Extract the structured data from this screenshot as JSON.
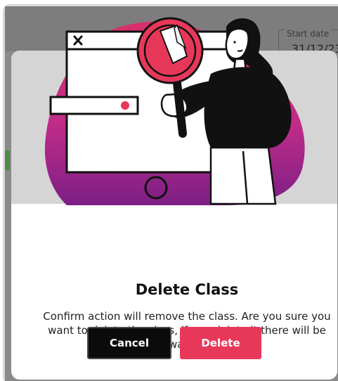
{
  "background": {
    "start_date_label": "Start date",
    "start_date_value": "31/12/23"
  },
  "dialog": {
    "title": "Delete Class",
    "message": "Confirm action will remove the class. Are you sure you want to delete the class, if you delete it there will be no way back.",
    "cancel_label": "Cancel",
    "delete_label": "Delete",
    "icon": "delete-class-illustration",
    "accent_color": "#e8385a",
    "hero_blob_color": "#c02c88",
    "magnifier_color": "#e8385a"
  }
}
